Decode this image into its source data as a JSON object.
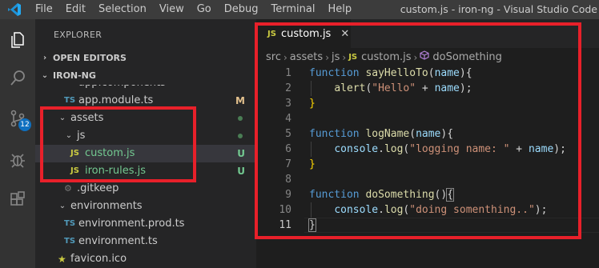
{
  "menu": {
    "logo": "vscode-logo",
    "items": [
      "File",
      "Edit",
      "Selection",
      "View",
      "Go",
      "Debug",
      "Terminal",
      "Help"
    ],
    "window_title": "custom.js - iron-ng - Visual Studio Code"
  },
  "activity": {
    "items": [
      "explorer-icon",
      "search-icon",
      "source-control-icon",
      "debug-icon",
      "extensions-icon"
    ],
    "scm_badge": "12"
  },
  "sidebar": {
    "title": "EXPLORER",
    "open_editors": "OPEN EDITORS",
    "project": "IRON-NG",
    "tree": [
      {
        "label": "app.components",
        "type": "ts",
        "status": ""
      },
      {
        "label": "app.module.ts",
        "type": "ts",
        "status": "M"
      },
      {
        "label": "assets",
        "type": "folder",
        "status": "dot"
      },
      {
        "label": "js",
        "type": "folder",
        "status": "dot"
      },
      {
        "label": "custom.js",
        "type": "js",
        "status": "U"
      },
      {
        "label": "iron-rules.js",
        "type": "js",
        "status": "U"
      },
      {
        "label": ".gitkeep",
        "type": "file",
        "status": ""
      },
      {
        "label": "environments",
        "type": "folder",
        "status": ""
      },
      {
        "label": "environment.prod.ts",
        "type": "ts",
        "status": ""
      },
      {
        "label": "environment.ts",
        "type": "ts",
        "status": ""
      },
      {
        "label": "favicon.ico",
        "type": "ico",
        "status": ""
      }
    ]
  },
  "editor": {
    "tab": {
      "icon": "JS",
      "name": "custom.js",
      "close": "✕"
    },
    "breadcrumb": [
      "src",
      "assets",
      "js",
      "custom.js",
      "doSomething"
    ],
    "lines": [
      {
        "n": "1",
        "text": "function sayHelloTo(name){"
      },
      {
        "n": "2",
        "text": "    alert(\"Hello\" + name);"
      },
      {
        "n": "3",
        "text": "}"
      },
      {
        "n": "4",
        "text": ""
      },
      {
        "n": "5",
        "text": "function logName(name){"
      },
      {
        "n": "6",
        "text": "    console.log(\"logging name: \" + name);"
      },
      {
        "n": "7",
        "text": "}"
      },
      {
        "n": "8",
        "text": ""
      },
      {
        "n": "9",
        "text": "function doSomething(){"
      },
      {
        "n": "10",
        "text": "    console.log(\"doing somenthing..\");"
      },
      {
        "n": "11",
        "text": "}"
      }
    ]
  },
  "colors": {
    "highlight_box": "#e8202a",
    "accent": "#0e70c0"
  }
}
